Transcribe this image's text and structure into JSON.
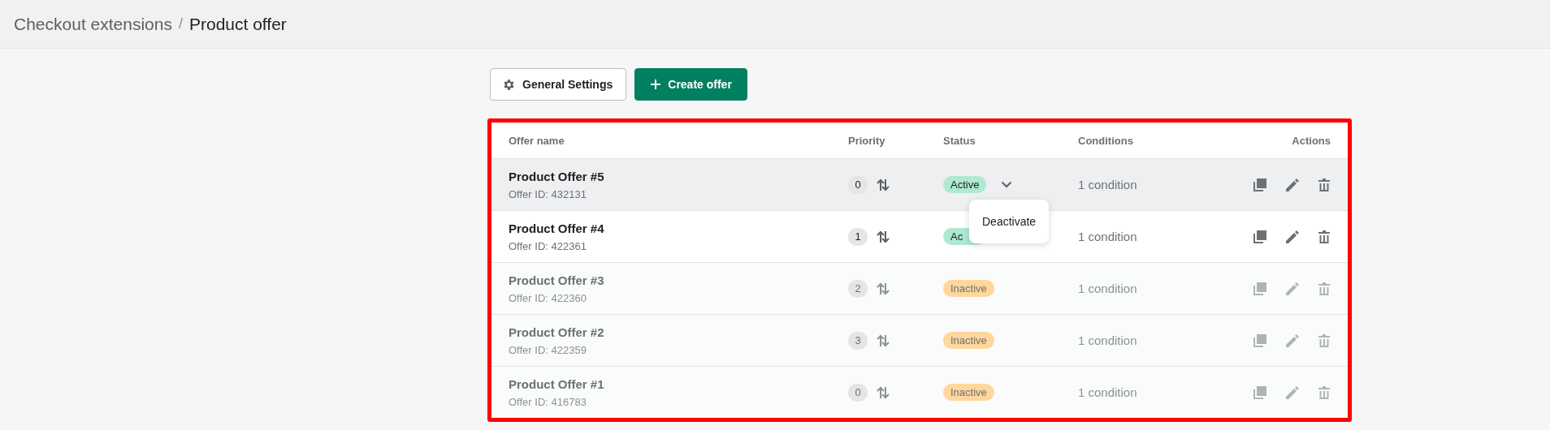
{
  "breadcrumb": {
    "parent": "Checkout extensions",
    "separator": "/",
    "current": "Product offer"
  },
  "buttons": [
    {
      "label": "General Settings",
      "kind": "settings"
    },
    {
      "label": "Create offer",
      "kind": "create"
    }
  ],
  "table": {
    "columns": [
      "Offer name",
      "Priority",
      "Status",
      "Conditions",
      "Actions"
    ],
    "rows": [
      {
        "name": "Product Offer #5",
        "offer_id": "Offer ID: 432131",
        "priority": "0",
        "status": {
          "label": "Active",
          "kind": "active"
        },
        "conditions": "1 condition",
        "highlighted": true,
        "status_menu": {
          "items": [
            "Deactivate"
          ]
        }
      },
      {
        "name": "Product Offer #4",
        "offer_id": "Offer ID: 422361",
        "priority": "1",
        "status": {
          "label": "Ac",
          "kind": "active"
        },
        "conditions": "1 condition",
        "highlighted": false
      },
      {
        "name": "Product Offer #3",
        "offer_id": "Offer ID: 422360",
        "priority": "2",
        "status": {
          "label": "Inactive",
          "kind": "inactive"
        },
        "conditions": "1 condition",
        "highlighted": false
      },
      {
        "name": "Product Offer #2",
        "offer_id": "Offer ID: 422359",
        "priority": "3",
        "status": {
          "label": "Inactive",
          "kind": "inactive"
        },
        "conditions": "1 condition",
        "highlighted": false
      },
      {
        "name": "Product Offer #1",
        "offer_id": "Offer ID: 416783",
        "priority": "0",
        "status": {
          "label": "Inactive",
          "kind": "inactive"
        },
        "conditions": "1 condition",
        "highlighted": false
      }
    ]
  }
}
